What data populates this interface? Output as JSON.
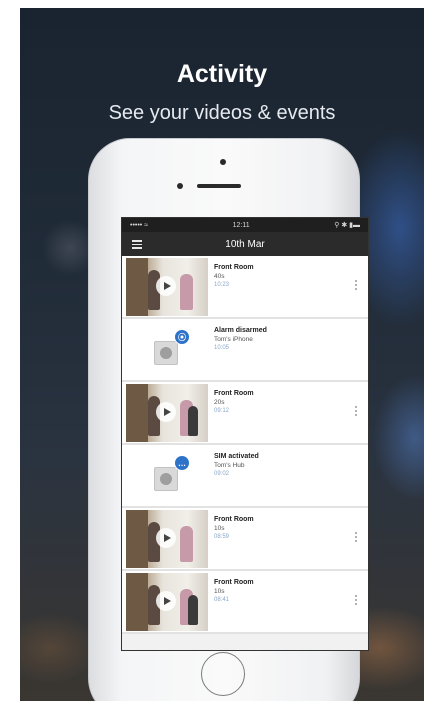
{
  "promo": {
    "title": "Activity",
    "subtitle": "See your videos & events"
  },
  "status_bar": {
    "carrier": "•••••  ≈",
    "time": "12:11",
    "indicators": "⚲ ✱ ▮▬"
  },
  "app_bar": {
    "date": "10th Mar",
    "menu_icon": "hamburger-menu-icon"
  },
  "activity_items": [
    {
      "kind": "video",
      "title": "Front Room",
      "subtitle": "40s",
      "time": "10:23"
    },
    {
      "kind": "event",
      "title": "Alarm disarmed",
      "subtitle": "Tom's iPhone",
      "time": "10:05",
      "badge_icon": "user-badge-icon",
      "badge": "⦿"
    },
    {
      "kind": "video",
      "title": "Front Room",
      "subtitle": "20s",
      "time": "09:12"
    },
    {
      "kind": "event",
      "title": "SIM activated",
      "subtitle": "Tom's Hub",
      "time": "09:02",
      "badge_icon": "chat-badge-icon",
      "badge": "…"
    },
    {
      "kind": "video",
      "title": "Front Room",
      "subtitle": "10s",
      "time": "08:59"
    },
    {
      "kind": "video",
      "title": "Front Room",
      "subtitle": "10s",
      "time": "08:41"
    }
  ],
  "colors": {
    "accent": "#2f73c9",
    "app_bar": "#2b2b2b",
    "status_bar": "#1f1f1f"
  }
}
